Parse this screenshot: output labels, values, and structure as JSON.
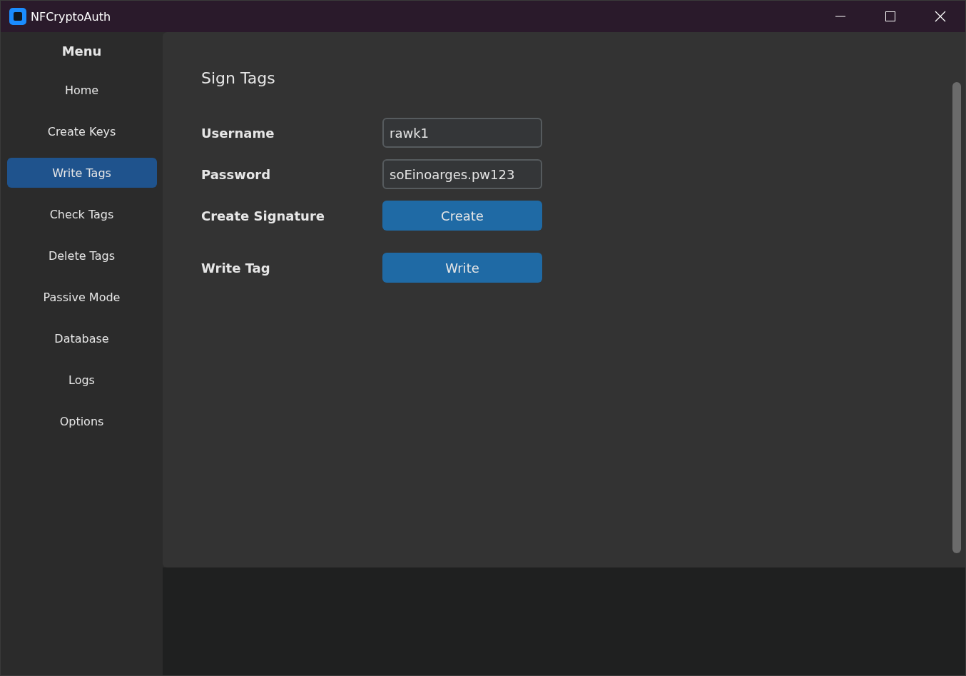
{
  "window": {
    "title": "NFCryptoAuth"
  },
  "sidebar": {
    "title": "Menu",
    "items": [
      {
        "label": "Home",
        "selected": false
      },
      {
        "label": "Create Keys",
        "selected": false
      },
      {
        "label": "Write Tags",
        "selected": true
      },
      {
        "label": "Check Tags",
        "selected": false
      },
      {
        "label": "Delete Tags",
        "selected": false
      },
      {
        "label": "Passive Mode",
        "selected": false
      },
      {
        "label": "Database",
        "selected": false
      },
      {
        "label": "Logs",
        "selected": false
      },
      {
        "label": "Options",
        "selected": false
      }
    ]
  },
  "page": {
    "title": "Sign Tags",
    "rows": [
      {
        "kind": "field",
        "label": "Username",
        "value": "rawk1"
      },
      {
        "kind": "field",
        "label": "Password",
        "value": "soEinoarges.pw123"
      },
      {
        "kind": "button",
        "label": "Create Signature",
        "button": "Create"
      },
      {
        "kind": "button",
        "label": "Write Tag",
        "button": "Write"
      }
    ]
  }
}
